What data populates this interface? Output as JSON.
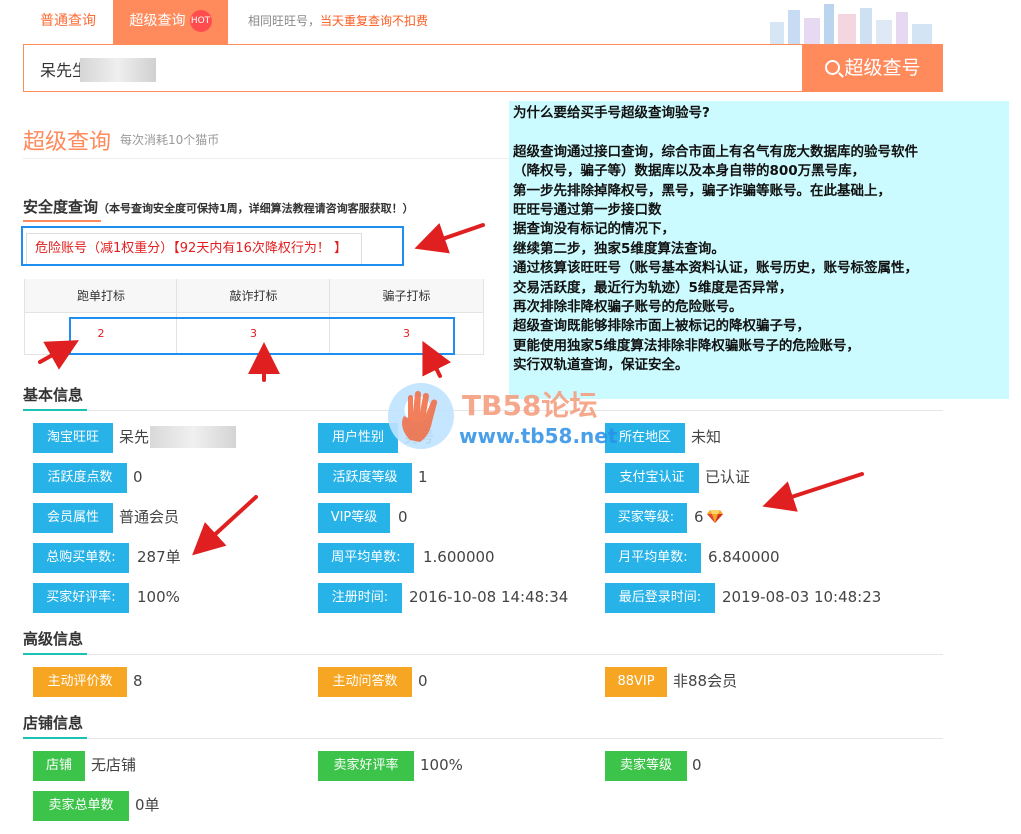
{
  "tabs": {
    "normal": "普通查询",
    "super": "超级查询",
    "hot_badge": "HOT",
    "note_prefix": "相同旺旺号，",
    "note_highlight": "当天重复查询不扣费"
  },
  "search": {
    "value": "呆先生",
    "button_label": "超级查号"
  },
  "page": {
    "title": "超级查询",
    "subtitle": "每次消耗10个猫币"
  },
  "safety": {
    "title": "安全度查询",
    "note": "（本号查询安全度可保持1周，详细算法教程请咨询客服获取！）",
    "risk_text": "危险账号（减1权重分）【92天内有16次降权行为！ 】",
    "table": {
      "headers": [
        "跑单打标",
        "敲诈打标",
        "骗子打标"
      ],
      "values": [
        "2",
        "3",
        "3"
      ]
    }
  },
  "basic": {
    "title": "基本信息",
    "rows": [
      [
        {
          "label": "淘宝旺旺",
          "value": "呆先"
        },
        {
          "label": "用户性别",
          "value": "男号"
        },
        {
          "label": "所在地区",
          "value": "未知"
        }
      ],
      [
        {
          "label": "活跃度点数",
          "value": "0"
        },
        {
          "label": "活跃度等级",
          "value": "1"
        },
        {
          "label": "支付宝认证",
          "value": "已认证"
        }
      ],
      [
        {
          "label": "会员属性",
          "value": "普通会员"
        },
        {
          "label": "VIP等级",
          "value": "0"
        },
        {
          "label": "买家等级:",
          "value": "6"
        }
      ],
      [
        {
          "label": "总购买单数:",
          "value": "287单"
        },
        {
          "label": "周平均单数:",
          "value": "1.600000"
        },
        {
          "label": "月平均单数:",
          "value": "6.840000"
        }
      ],
      [
        {
          "label": "买家好评率:",
          "value": "100%"
        },
        {
          "label": "注册时间:",
          "value": "2016-10-08 14:48:34"
        },
        {
          "label": "最后登录时间:",
          "value": "2019-08-03 10:48:23"
        }
      ]
    ]
  },
  "advanced": {
    "title": "高级信息",
    "items": [
      {
        "label": "主动评价数",
        "value": "8"
      },
      {
        "label": "主动问答数",
        "value": "0"
      },
      {
        "label": "88VIP",
        "value": "非88会员"
      }
    ]
  },
  "shop": {
    "title": "店铺信息",
    "items": [
      {
        "label": "店铺",
        "value": "无店铺"
      },
      {
        "label": "卖家好评率",
        "value": "100%"
      },
      {
        "label": "卖家等级",
        "value": "0"
      },
      {
        "label": "卖家总单数",
        "value": "0单"
      }
    ]
  },
  "callout": {
    "lines": [
      "为什么要给买手号超级查询验号?",
      "",
      "超级查询通过接口查询，综合市面上有名气有庞大数据库的验号软件",
      "（降权号，骗子等）数据库以及本身自带的800万黑号库，",
      "第一步先排除掉降权号，黑号，骗子诈骗等账号。在此基础上，",
      "旺旺号通过第一步接口数",
      "据查询没有标记的情况下，",
      "继续第二步，独家5维度算法查询。",
      "通过核算该旺旺号（账号基本资料认证，账号历史，账号标签属性，",
      "交易活跃度，最近行为轨迹）5维度是否异常，",
      "再次排除非降权骗子账号的危险账号。",
      "超级查询既能够排除市面上被标记的降权骗子号，",
      "更能使用独家5维度算法排除非降权骗账号子的危险账号，",
      "实行双轨道查询，保证安全。"
    ]
  },
  "watermark": {
    "title": "TB58论坛",
    "url": "www.tb58.net"
  },
  "colors": {
    "accent": "#ff8a5c",
    "label_blue": "#27b2e8",
    "label_orange": "#f6a623",
    "label_green": "#3cc34a",
    "callout_bg": "#ccfbff",
    "annotation": "#e02020"
  }
}
